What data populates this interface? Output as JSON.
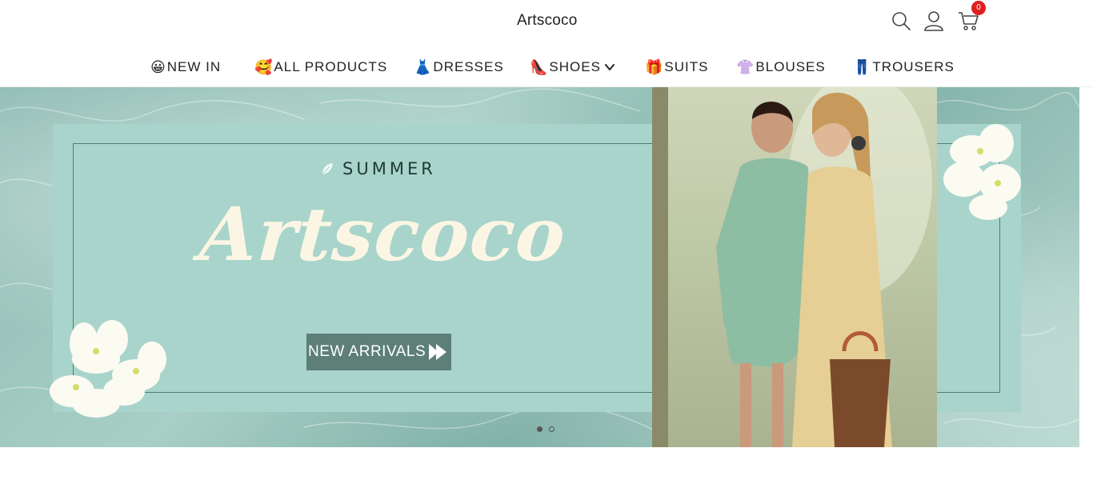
{
  "header": {
    "logo_text": "Artscoco",
    "icons": [
      "search-icon",
      "account-icon",
      "cart-icon"
    ],
    "cart_count": "0"
  },
  "nav": {
    "items": [
      {
        "emoji": "😀",
        "label": "NEW IN"
      },
      {
        "emoji": "🥰",
        "label": "ALL PRODUCTS"
      },
      {
        "emoji": "👗",
        "label": "DRESSES"
      },
      {
        "emoji": "👠",
        "label": "SHOES"
      },
      {
        "emoji": "🎁",
        "label": "SUITS"
      },
      {
        "emoji": "👚",
        "label": "BLOUSES"
      },
      {
        "emoji": "👖",
        "label": "TROUSERS"
      }
    ]
  },
  "hero": {
    "kicker": "SUMMER",
    "brand": "Artscoco",
    "cta_label": "NEW ARRIVALS",
    "slide_count": 2,
    "active_slide": 1
  },
  "colors": {
    "badge": "#e02020",
    "hero_panel": "#a9d4cc",
    "cta_bg": "#5d7f78",
    "script_text": "#fbf6e4"
  }
}
